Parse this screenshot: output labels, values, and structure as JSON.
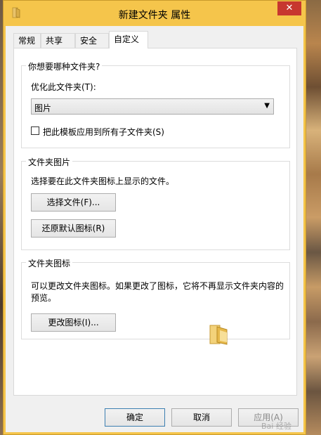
{
  "window": {
    "title": "新建文件夹 属性",
    "close_glyph": "✕"
  },
  "tabs": [
    {
      "label": "常规"
    },
    {
      "label": "共享"
    },
    {
      "label": "安全"
    },
    {
      "label": "自定义",
      "active": true
    }
  ],
  "group_type": {
    "title": "你想要哪种文件夹?",
    "optimize_label": "优化此文件夹(T):",
    "selected_value": "图片",
    "apply_subfolders_label": "把此模板应用到所有子文件夹(S)",
    "apply_subfolders_checked": false
  },
  "group_picture": {
    "title": "文件夹图片",
    "description": "选择要在此文件夹图标上显示的文件。",
    "choose_file_button": "选择文件(F)...",
    "restore_default_button": "还原默认图标(R)"
  },
  "group_icon": {
    "title": "文件夹图标",
    "description": "可以更改文件夹图标。如果更改了图标，它将不再显示文件夹内容的预览。",
    "change_icon_button": "更改图标(I)..."
  },
  "footer": {
    "ok_button": "确定",
    "cancel_button": "取消",
    "apply_button": "应用(A)"
  },
  "watermark": "Bai 经验",
  "colors": {
    "window_frame": "#f5c54b",
    "close_button": "#c7372f",
    "client_background": "#f0f0f0",
    "panel_background": "#ffffff",
    "default_button_border": "#3c7fb1"
  }
}
